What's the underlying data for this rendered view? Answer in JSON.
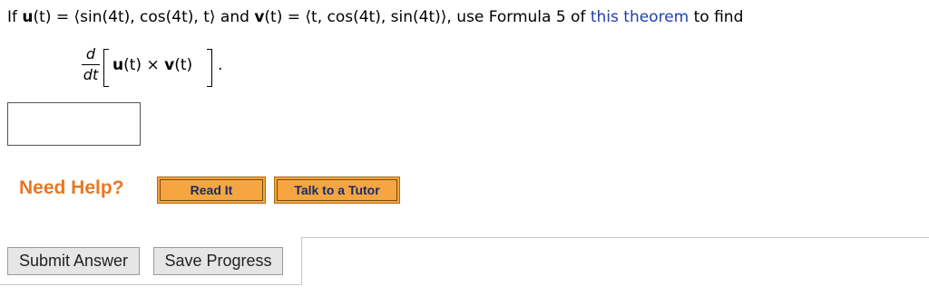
{
  "question": {
    "if": "If",
    "u_name": "u",
    "u_arg": "(t)",
    "equals1": " = ⟨sin(4t), cos(4t), t⟩",
    "and": " and ",
    "v_name": "v",
    "v_arg": "(t)",
    "equals2": " = ⟨t, cos(4t), sin(4t)⟩,",
    "use": " use Formula 5 of ",
    "link_text": "this theorem",
    "to_find": " to find"
  },
  "derivative": {
    "numerator": "d",
    "denominator": "dt",
    "u_name": "u",
    "u_arg": "(t)",
    "times": " × ",
    "v_name": "v",
    "v_arg": "(t)",
    "period": "."
  },
  "answer": {
    "value": ""
  },
  "help": {
    "label": "Need Help?",
    "read_it": "Read It",
    "talk_tutor": "Talk to a Tutor"
  },
  "actions": {
    "submit": "Submit Answer",
    "save": "Save Progress"
  },
  "colors": {
    "link": "#1f3fb0",
    "help_label": "#e87722",
    "help_button": "#f5a640"
  }
}
